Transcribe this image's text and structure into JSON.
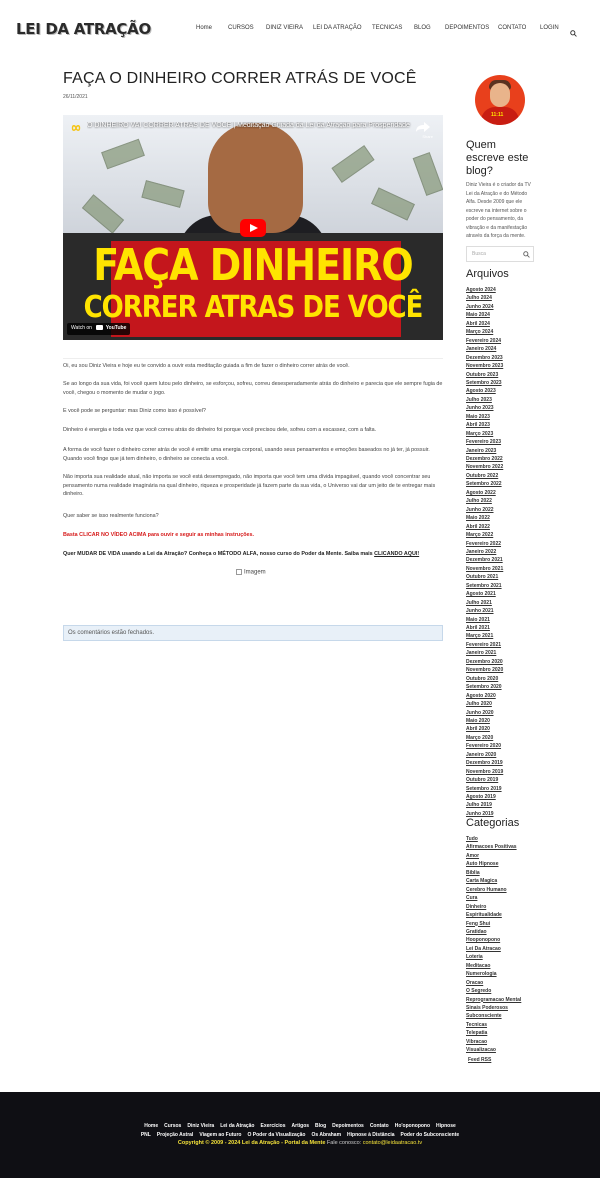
{
  "header": {
    "logo": "LEI DA ATRAÇÃO",
    "nav": [
      "Home",
      "CURSOS",
      "DINIZ VIEIRA",
      "LEI DA ATRAÇÃO",
      "TECNICAS",
      "BLOG",
      "DEPOIMENTOS",
      "CONTATO",
      "LOGIN"
    ],
    "search_icon": "search-icon"
  },
  "post": {
    "title": "FAÇA O DINHEIRO CORRER ATRÁS DE VOCÊ",
    "date": "26/11/2021",
    "video": {
      "title": "O DINHEIRO VAI CORRER ATRÁS DE VOCÊ | Meditação Guiada da Lei da Atração para Prosperidade",
      "thumb_line1": "FAÇA DINHEIRO",
      "thumb_line2": "CORRER ATRAS DE VOCÊ",
      "share": "Share",
      "watch_on": "Watch on",
      "youtube": "YouTube"
    },
    "paragraphs": [
      "Oi, eu sou Diniz Vieira e hoje eu te convido a ouvir esta meditação guiada a fim de fazer o dinheiro correr atrás de você.",
      "Se ao longo da sua vida, foi você quem lutou pelo dinheiro, se esforçou, sofreu, correu desesperadamente atrás do dinheiro e parecia que ele sempre fugia de você, chegou o momento de mudar o jogo.",
      "E você pode se perguntar: mas Diniz como isso é possível?",
      "Dinheiro é energia e toda vez que você correu atrás do dinheiro foi porque você precisou dele, sofreu com a escassez, com a falta.",
      "A forma de você fazer o dinheiro correr atrás de você é emitir uma energia corporal, usando seus pensamentos e emoções baseados no já ter, já possuir. Quando você finge que já tem dinheiro, o dinheiro se conecta a você.",
      "Não importa sua realidade atual, não importa se você está desempregado, não importa que você tem uma dívida impagável, quando você concentrar seu pensamento numa realidade imaginária na qual dinheiro, riqueza e prosperidade já fazem parte da sua vida, o Universo vai dar um jeito de te entregar mais dinheiro.",
      "Quer saber se isso realmente funciona?"
    ],
    "cta_red": "Basta CLICAR NO VÍDEO ACIMA para ouvir e seguir as minhas instruções.",
    "cta_bold": "Quer MUDAR DE VIDA usando a Lei da Atração? Conheça o MÉTODO ALFA, nosso curso do Poder da Mente. Saiba mais ",
    "cta_link": "CLICANDO AQUI!",
    "image_alt": "Imagem",
    "comments_closed": "Os comentários estão fechados."
  },
  "sidebar": {
    "author_title": "Quem escreve este blog?",
    "bio": "Diniz Vieira é o criador da TV Lei da Atração e do Método Alfa. Desde 2009 que ele escreve na internet sobre o poder do pensamento, da vibração e da manifestação através da força da mente.",
    "search_placeholder": "Busca",
    "archives_title": "Arquivos",
    "archives": [
      "Agosto 2024",
      "Julho 2024",
      "Junho 2024",
      "Maio 2024",
      "Abril 2024",
      "Março 2024",
      "Fevereiro 2024",
      "Janeiro 2024",
      "Dezembro 2023",
      "Novembro 2023",
      "Outubro 2023",
      "Setembro 2023",
      "Agosto 2023",
      "Julho 2023",
      "Junho 2023",
      "Maio 2023",
      "Abril 2023",
      "Março 2023",
      "Fevereiro 2023",
      "Janeiro 2023",
      "Dezembro 2022",
      "Novembro 2022",
      "Outubro 2022",
      "Setembro 2022",
      "Agosto 2022",
      "Julho 2022",
      "Junho 2022",
      "Maio 2022",
      "Abril 2022",
      "Março 2022",
      "Fevereiro 2022",
      "Janeiro 2022",
      "Dezembro 2021",
      "Novembro 2021",
      "Outubro 2021",
      "Setembro 2021",
      "Agosto 2021",
      "Julho 2021",
      "Junho 2021",
      "Maio 2021",
      "Abril 2021",
      "Março 2021",
      "Fevereiro 2021",
      "Janeiro 2021",
      "Dezembro 2020",
      "Novembro 2020",
      "Outubro 2020",
      "Setembro 2020",
      "Agosto 2020",
      "Julho 2020",
      "Junho 2020",
      "Maio 2020",
      "Abril 2020",
      "Março 2020",
      "Fevereiro 2020",
      "Janeiro 2020",
      "Dezembro 2019",
      "Novembro 2019",
      "Outubro 2019",
      "Setembro 2019",
      "Agosto 2019",
      "Julho 2019",
      "Junho 2019"
    ],
    "categories_title": "Categorias",
    "categories": [
      "Tudo",
      "Afirmacoes Positivas",
      "Amor",
      "Auto Hipnose",
      "Biblia",
      "Carta Magica",
      "Cerebro Humano",
      "Cura",
      "Dinheiro",
      "Espiritualidade",
      "Feng Shui",
      "Gratidao",
      "Hooponopono",
      "Lei Da Atracao",
      "Loteria",
      "Meditacao",
      "Numerologia",
      "Oracao",
      "O Segredo",
      "Reprogramacao Mental",
      "Sinais Poderosos",
      "Subconsciente",
      "Tecnicas",
      "Telepatia",
      "Vibracao",
      "Visualizacao"
    ],
    "feed": "Feed RSS"
  },
  "footer": {
    "links_row1": [
      "Home",
      "Cursos",
      "Diniz Vieira",
      "Lei da Atração",
      "Exercícios",
      "Artigos",
      "Blog",
      "Depoimentos",
      "Contato",
      "Ho'oponopono",
      "Hipnose"
    ],
    "links_row2": [
      "PNL",
      "Projeção Astral",
      "Viagem ao Futuro",
      "O Poder da Visualização",
      "Os Abraham",
      "Hipnose à Distância",
      "Poder do Subconsciente"
    ],
    "copyright": "Copyright © 2009 - 2024 Lei da Atração - Portal da Mente",
    "contact_label": " Fale conosco: ",
    "email": "contato@leidaatracao.tv"
  },
  "colors": {
    "accent_red": "#d61a1a",
    "footer_bg": "#0f0f14",
    "footer_yellow": "#f5e33a",
    "notice_bg": "#e8f0f8"
  }
}
